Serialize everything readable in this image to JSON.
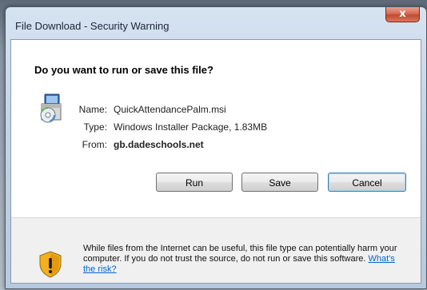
{
  "window": {
    "title": "File Download - Security Warning",
    "close_symbol": "x"
  },
  "dialog": {
    "question": "Do you want to run or save this file?",
    "file_icon": "installer-package-icon",
    "fields": [
      {
        "label": "Name:",
        "value": "QuickAttendancePalm.msi"
      },
      {
        "label": "Type:",
        "value": "Windows Installer Package, 1.83MB"
      },
      {
        "label": "From:",
        "value": "gb.dadeschools.net"
      }
    ],
    "buttons": {
      "run": "Run",
      "save": "Save",
      "cancel": "Cancel"
    }
  },
  "footer": {
    "shield_icon": "warning-shield-icon",
    "warning": "While files from the Internet can be useful, this file type can potentially harm your computer. If you do not trust the source, do not run or save this software.",
    "risk_link": "What's the risk?"
  },
  "colors": {
    "link": "#0066cc",
    "close_button": "#c04a30",
    "default_button_border": "#3c7fb1"
  }
}
